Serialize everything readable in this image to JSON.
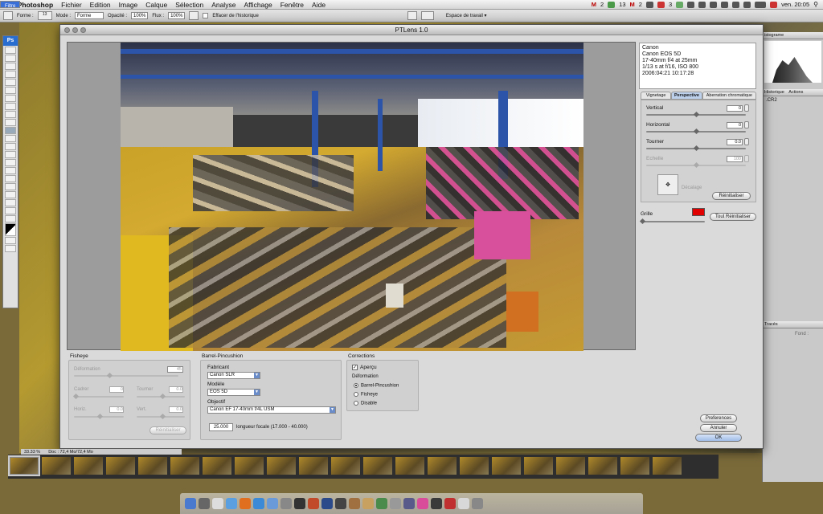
{
  "menubar": {
    "apple": "",
    "items": [
      "Photoshop",
      "Fichier",
      "Edition",
      "Image",
      "Calque",
      "Sélection",
      "Filtre",
      "Analyse",
      "Affichage",
      "Fenêtre",
      "Aide"
    ],
    "clock": "ven. 20:05",
    "status_counts": [
      "2",
      "13",
      "2",
      "3"
    ]
  },
  "options_bar": {
    "forme_label": "Forme :",
    "mode_label": "Mode :",
    "mode_value": "Forme",
    "opacite_label": "Opacité :",
    "opacite_value": "100%",
    "flux_label": "Flux :",
    "flux_value": "100%",
    "effacer_label": "Effacer de l'historique",
    "brush_size": "13",
    "workspace_label": "Espace de travail"
  },
  "dialog": {
    "title": "PTLens 1.0",
    "info_lines": [
      "Canon",
      "Canon EOS 5D",
      "17-40mm f/4 at 25mm",
      "1/13 s at f/16, ISO 800",
      "2006:04:21 10:17:28"
    ],
    "tabs": [
      "Vignetage",
      "Perspective",
      "Aberration chromatique"
    ],
    "perspective": {
      "vertical_label": "Vertical",
      "vertical_value": "0",
      "horizontal_label": "Horizontal",
      "horizontal_value": "0",
      "tourner_label": "Tourner",
      "tourner_value": "0.0",
      "echelle_label": "Echelle",
      "echelle_value": "100",
      "decalage_label": "Décalage",
      "reset_label": "Réinitialiser"
    },
    "grille_label": "Grille",
    "grille_color": "#e00000",
    "tout_reset_label": "Tout Réinitialiser",
    "fisheye": {
      "title": "Fisheye",
      "deformation_label": "Déformation",
      "deformation_value": "45",
      "cadrer_label": "Cadrer",
      "cadrer_value": "0",
      "tourner_label": "Tourner",
      "tourner_value": "0.0",
      "horiz_label": "Horiz.",
      "horiz_value": "0.0",
      "vert_label": "Vert.",
      "vert_value": "0.0",
      "reset_label": "Réinitialiser"
    },
    "barrel": {
      "title": "Barrel-Pincushion",
      "fabricant_label": "Fabricant",
      "fabricant_value": "Canon SLR",
      "modele_label": "Modèle",
      "modele_value": "EOS 5D",
      "objectif_label": "Objectif",
      "objectif_value": "Canon EF 17-40mm f/4L USM",
      "focal_value": "25.000",
      "focal_label": "longueur focale (17.000 - 40.000)"
    },
    "corrections": {
      "title": "Corrections",
      "apercu_label": "Aperçu",
      "deformation_label": "Déformation",
      "options": [
        "Barrel-Pincushion",
        "Fisheye",
        "Disable"
      ],
      "selected": 0
    },
    "buttons": {
      "preferences": "Preferences",
      "annuler": "Annuler",
      "ok": "OK"
    }
  },
  "right_panels": {
    "top_tab": "istograme",
    "historique_tab": "Historique",
    "actions_tab": "Actions",
    "file_label": ".CR2",
    "traces_tab": "Tracés",
    "fond_label": "Fond :"
  },
  "statusbar": {
    "zoom": "33.33 %",
    "doc": "Doc : 72,4 Mo/72,4 Mo"
  }
}
